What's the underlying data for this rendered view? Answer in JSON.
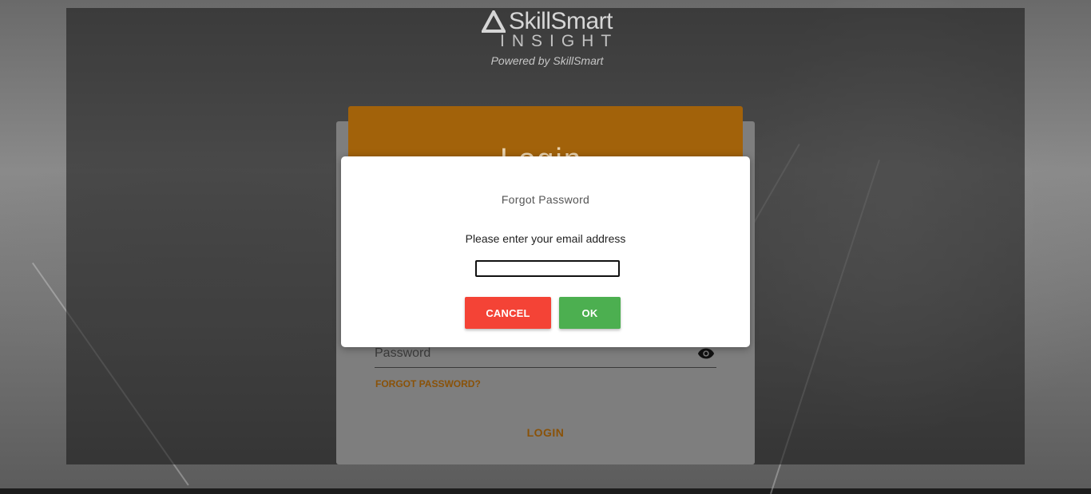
{
  "brand": {
    "name": "SkillSmart",
    "product": "INSIGHT",
    "powered_by": "Powered by SkillSmart"
  },
  "login": {
    "header_title": "Login",
    "password_label": "Password",
    "password_toggle_icon": "eye-icon",
    "forgot_link": "FORGOT PASSWORD?",
    "login_button": "LOGIN"
  },
  "modal": {
    "title": "Forgot Password",
    "message": "Please enter your email address",
    "email_value": "",
    "cancel_label": "CANCEL",
    "ok_label": "OK"
  },
  "colors": {
    "accent": "#a2620a",
    "link": "#8a5208",
    "cancel": "#f44336",
    "ok": "#4caf50"
  }
}
